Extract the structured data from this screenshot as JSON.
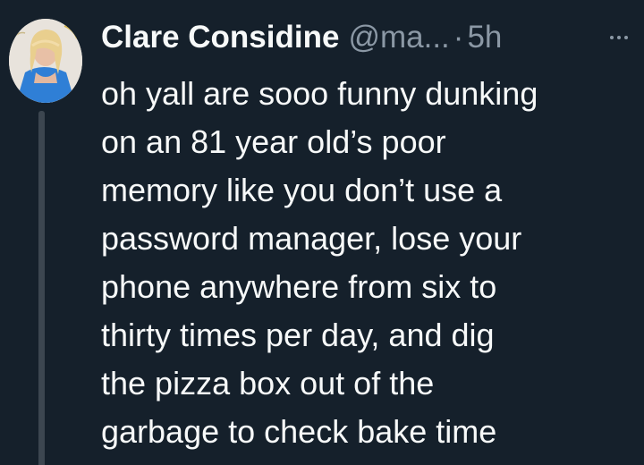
{
  "tweet": {
    "author": {
      "display_name": "Clare Considine",
      "handle": "@ma...",
      "avatar_icon": "profile-avatar"
    },
    "separator": "·",
    "timestamp": "5h",
    "more_icon": "more-horizontal-icon",
    "text_lines": [
      "oh yall are sooo funny dunking",
      "on an 81 year old’s poor",
      "memory like you don’t use a",
      "password manager, lose your",
      "phone anywhere from six to",
      "thirty times per day, and dig",
      "the pizza box out of the",
      "garbage to check bake time"
    ]
  },
  "colors": {
    "background": "#15202b",
    "text_primary": "#f7f9f9",
    "text_secondary": "#8b98a5",
    "thread_line": "#3c4650"
  }
}
